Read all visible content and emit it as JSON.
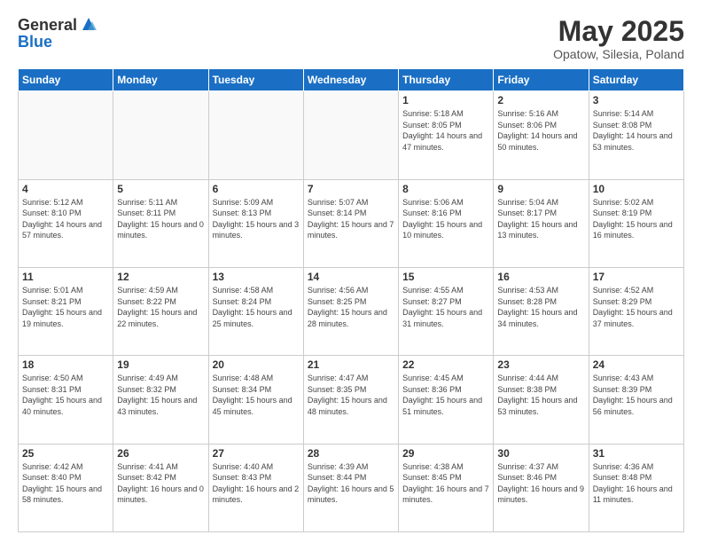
{
  "logo": {
    "text_general": "General",
    "text_blue": "Blue"
  },
  "title": "May 2025",
  "subtitle": "Opatow, Silesia, Poland",
  "days_of_week": [
    "Sunday",
    "Monday",
    "Tuesday",
    "Wednesday",
    "Thursday",
    "Friday",
    "Saturday"
  ],
  "weeks": [
    [
      {
        "day": "",
        "info": ""
      },
      {
        "day": "",
        "info": ""
      },
      {
        "day": "",
        "info": ""
      },
      {
        "day": "",
        "info": ""
      },
      {
        "day": "1",
        "info": "Sunrise: 5:18 AM\nSunset: 8:05 PM\nDaylight: 14 hours and 47 minutes."
      },
      {
        "day": "2",
        "info": "Sunrise: 5:16 AM\nSunset: 8:06 PM\nDaylight: 14 hours and 50 minutes."
      },
      {
        "day": "3",
        "info": "Sunrise: 5:14 AM\nSunset: 8:08 PM\nDaylight: 14 hours and 53 minutes."
      }
    ],
    [
      {
        "day": "4",
        "info": "Sunrise: 5:12 AM\nSunset: 8:10 PM\nDaylight: 14 hours and 57 minutes."
      },
      {
        "day": "5",
        "info": "Sunrise: 5:11 AM\nSunset: 8:11 PM\nDaylight: 15 hours and 0 minutes."
      },
      {
        "day": "6",
        "info": "Sunrise: 5:09 AM\nSunset: 8:13 PM\nDaylight: 15 hours and 3 minutes."
      },
      {
        "day": "7",
        "info": "Sunrise: 5:07 AM\nSunset: 8:14 PM\nDaylight: 15 hours and 7 minutes."
      },
      {
        "day": "8",
        "info": "Sunrise: 5:06 AM\nSunset: 8:16 PM\nDaylight: 15 hours and 10 minutes."
      },
      {
        "day": "9",
        "info": "Sunrise: 5:04 AM\nSunset: 8:17 PM\nDaylight: 15 hours and 13 minutes."
      },
      {
        "day": "10",
        "info": "Sunrise: 5:02 AM\nSunset: 8:19 PM\nDaylight: 15 hours and 16 minutes."
      }
    ],
    [
      {
        "day": "11",
        "info": "Sunrise: 5:01 AM\nSunset: 8:21 PM\nDaylight: 15 hours and 19 minutes."
      },
      {
        "day": "12",
        "info": "Sunrise: 4:59 AM\nSunset: 8:22 PM\nDaylight: 15 hours and 22 minutes."
      },
      {
        "day": "13",
        "info": "Sunrise: 4:58 AM\nSunset: 8:24 PM\nDaylight: 15 hours and 25 minutes."
      },
      {
        "day": "14",
        "info": "Sunrise: 4:56 AM\nSunset: 8:25 PM\nDaylight: 15 hours and 28 minutes."
      },
      {
        "day": "15",
        "info": "Sunrise: 4:55 AM\nSunset: 8:27 PM\nDaylight: 15 hours and 31 minutes."
      },
      {
        "day": "16",
        "info": "Sunrise: 4:53 AM\nSunset: 8:28 PM\nDaylight: 15 hours and 34 minutes."
      },
      {
        "day": "17",
        "info": "Sunrise: 4:52 AM\nSunset: 8:29 PM\nDaylight: 15 hours and 37 minutes."
      }
    ],
    [
      {
        "day": "18",
        "info": "Sunrise: 4:50 AM\nSunset: 8:31 PM\nDaylight: 15 hours and 40 minutes."
      },
      {
        "day": "19",
        "info": "Sunrise: 4:49 AM\nSunset: 8:32 PM\nDaylight: 15 hours and 43 minutes."
      },
      {
        "day": "20",
        "info": "Sunrise: 4:48 AM\nSunset: 8:34 PM\nDaylight: 15 hours and 45 minutes."
      },
      {
        "day": "21",
        "info": "Sunrise: 4:47 AM\nSunset: 8:35 PM\nDaylight: 15 hours and 48 minutes."
      },
      {
        "day": "22",
        "info": "Sunrise: 4:45 AM\nSunset: 8:36 PM\nDaylight: 15 hours and 51 minutes."
      },
      {
        "day": "23",
        "info": "Sunrise: 4:44 AM\nSunset: 8:38 PM\nDaylight: 15 hours and 53 minutes."
      },
      {
        "day": "24",
        "info": "Sunrise: 4:43 AM\nSunset: 8:39 PM\nDaylight: 15 hours and 56 minutes."
      }
    ],
    [
      {
        "day": "25",
        "info": "Sunrise: 4:42 AM\nSunset: 8:40 PM\nDaylight: 15 hours and 58 minutes."
      },
      {
        "day": "26",
        "info": "Sunrise: 4:41 AM\nSunset: 8:42 PM\nDaylight: 16 hours and 0 minutes."
      },
      {
        "day": "27",
        "info": "Sunrise: 4:40 AM\nSunset: 8:43 PM\nDaylight: 16 hours and 2 minutes."
      },
      {
        "day": "28",
        "info": "Sunrise: 4:39 AM\nSunset: 8:44 PM\nDaylight: 16 hours and 5 minutes."
      },
      {
        "day": "29",
        "info": "Sunrise: 4:38 AM\nSunset: 8:45 PM\nDaylight: 16 hours and 7 minutes."
      },
      {
        "day": "30",
        "info": "Sunrise: 4:37 AM\nSunset: 8:46 PM\nDaylight: 16 hours and 9 minutes."
      },
      {
        "day": "31",
        "info": "Sunrise: 4:36 AM\nSunset: 8:48 PM\nDaylight: 16 hours and 11 minutes."
      }
    ]
  ]
}
